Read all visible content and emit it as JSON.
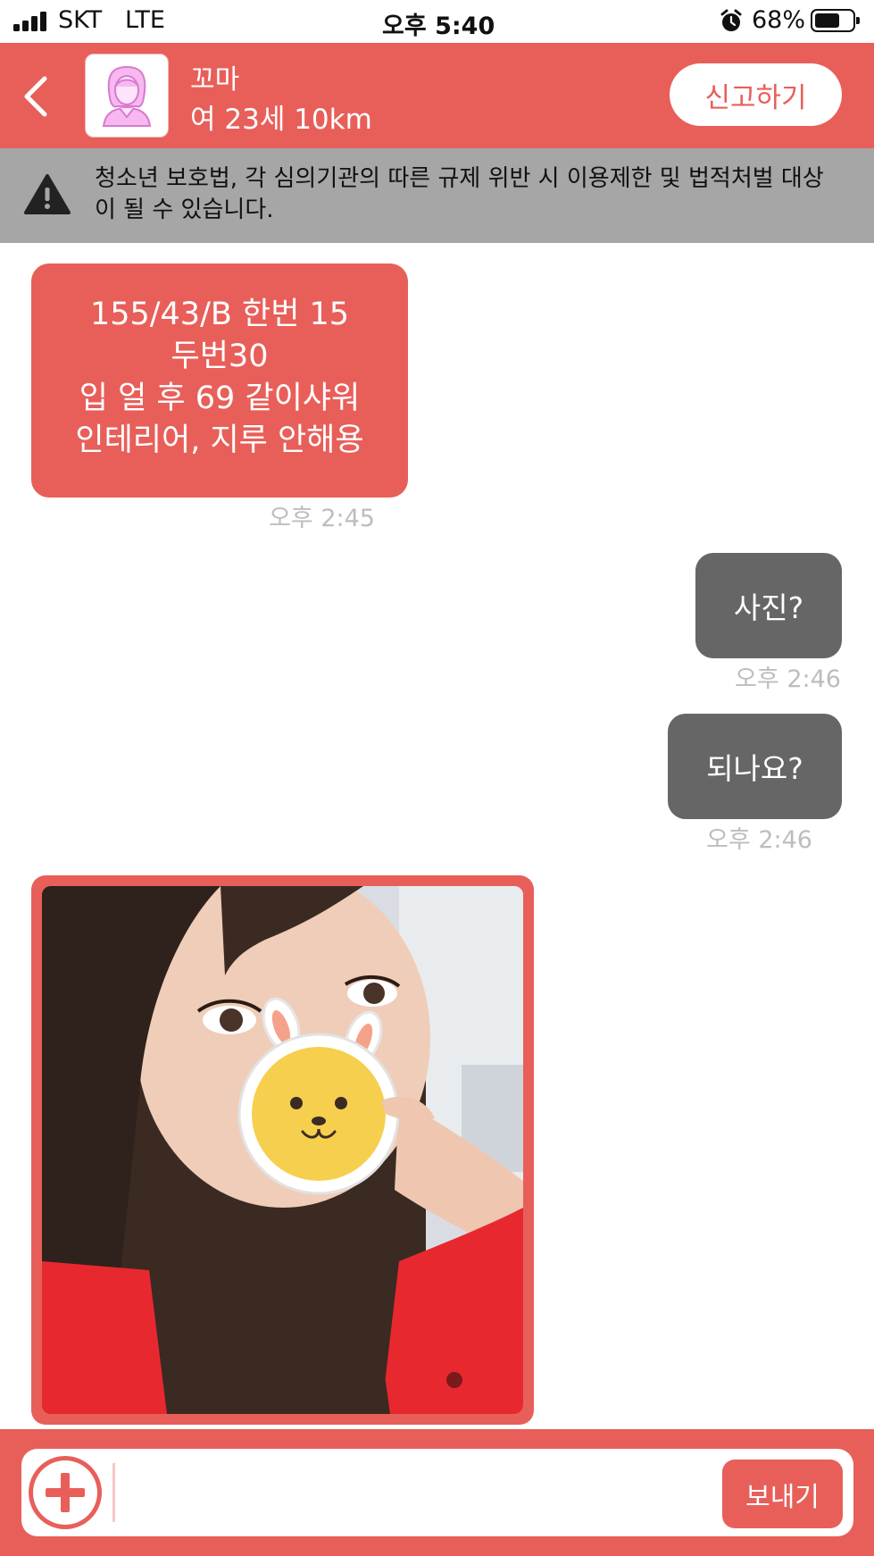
{
  "status_bar": {
    "carrier": "SKT",
    "network": "LTE",
    "time": "오후 5:40",
    "battery_percent": "68%",
    "battery_level": 0.68
  },
  "header": {
    "name": "꼬마",
    "info": "여 23세 10km",
    "report_label": "신고하기"
  },
  "warning": {
    "text": "청소년 보호법, 각 심의기관의 따른 규제 위반 시 이용제한 및 법적처벌 대상이 될 수 있습니다."
  },
  "messages": [
    {
      "side": "in",
      "lines": [
        "155/43/B 한번 15",
        "두번30",
        "입 얼 후 69 같이샤워",
        "인테리어, 지루 안해용"
      ],
      "time": "오후 2:45"
    },
    {
      "side": "out",
      "text": "사진?",
      "time": "오후 2:46"
    },
    {
      "side": "out",
      "text": "되나요?",
      "time": "오후 2:46"
    },
    {
      "side": "in",
      "type": "photo"
    }
  ],
  "input": {
    "value": "",
    "send_label": "보내기"
  },
  "colors": {
    "accent": "#e85f5a",
    "outgoing_bubble": "#666666",
    "warning_bg": "#a6a6a6",
    "time_text": "#bdbdbd"
  },
  "icons": [
    "signal-icon",
    "alarm-icon",
    "battery-icon",
    "back-chevron-icon",
    "female-avatar-icon",
    "warning-triangle-icon",
    "plus-icon"
  ]
}
